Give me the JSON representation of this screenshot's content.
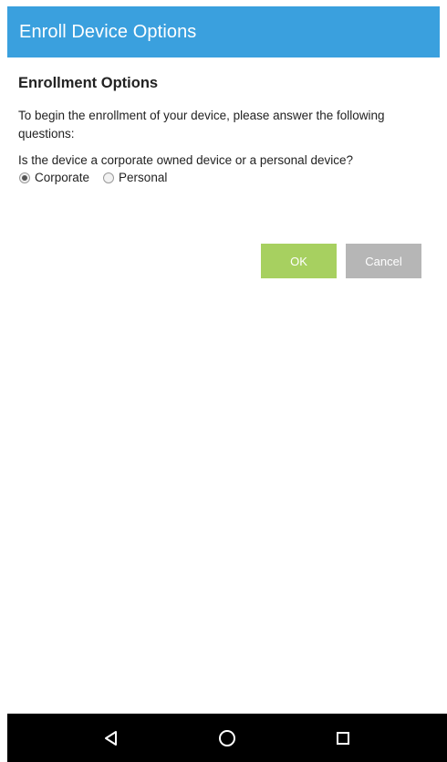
{
  "app_bar": {
    "title": "Enroll Device Options"
  },
  "content": {
    "section_title": "Enrollment Options",
    "intro": "To begin the enrollment of your device, please answer the following questions:",
    "question": "Is the device a corporate owned device or a personal device?",
    "options": [
      {
        "label": "Corporate",
        "selected": true
      },
      {
        "label": "Personal",
        "selected": false
      }
    ]
  },
  "buttons": {
    "ok_label": "OK",
    "cancel_label": "Cancel"
  },
  "nav": {
    "back_icon": "back-triangle-icon",
    "home_icon": "home-circle-icon",
    "recents_icon": "recents-square-icon"
  },
  "colors": {
    "app_bar": "#3aa0de",
    "ok_button": "#a7d060",
    "cancel_button": "#b6b6b6",
    "nav_bar": "#000000"
  }
}
